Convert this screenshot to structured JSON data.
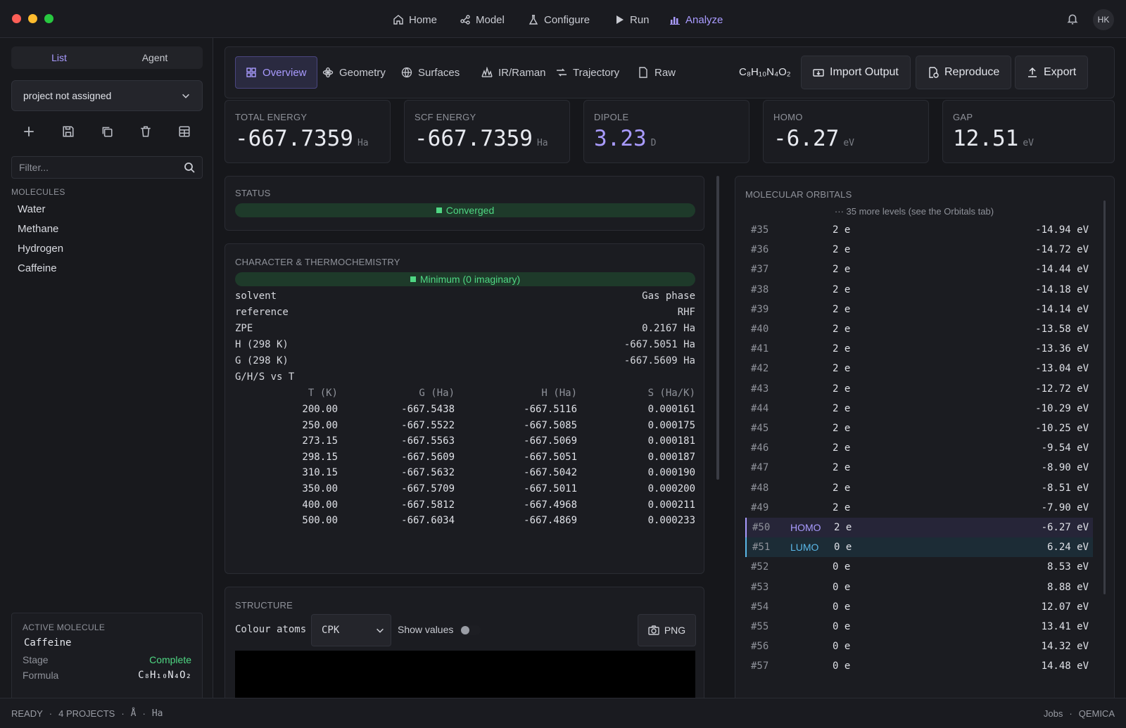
{
  "window": {
    "nav": [
      {
        "label": "Home",
        "icon": "home-icon"
      },
      {
        "label": "Model",
        "icon": "share-icon"
      },
      {
        "label": "Configure",
        "icon": "flask-icon"
      },
      {
        "label": "Run",
        "icon": "play-icon"
      },
      {
        "label": "Analyze",
        "icon": "bar-chart-icon",
        "active": true
      }
    ],
    "user_initials": "HK"
  },
  "sidebar": {
    "toggle": {
      "list": "List",
      "agent": "Agent"
    },
    "project": "project not assigned",
    "filter_placeholder": "Filter...",
    "molecules_label": "MOLECULES",
    "molecules": [
      "Water",
      "Methane",
      "Hydrogen",
      "Caffeine"
    ],
    "active": {
      "title": "ACTIVE MOLECULE",
      "name": "Caffeine",
      "stage_label": "Stage",
      "stage": "Complete",
      "formula_label": "Formula",
      "formula": "C₈H₁₀N₄O₂"
    }
  },
  "tabs": [
    "Overview",
    "Geometry",
    "Surfaces",
    "IR/Raman",
    "Trajectory",
    "Raw"
  ],
  "formula": "C₈H₁₀N₄O₂",
  "actions": {
    "import": "Import Output",
    "reproduce": "Reproduce",
    "export": "Export"
  },
  "metrics": [
    {
      "label": "TOTAL ENERGY",
      "value": "-667.7359",
      "unit": "Ha"
    },
    {
      "label": "SCF ENERGY",
      "value": "-667.7359",
      "unit": "Ha"
    },
    {
      "label": "DIPOLE",
      "value": "3.23",
      "unit": "D",
      "accent": "#a99bff"
    },
    {
      "label": "HOMO",
      "value": "-6.27",
      "unit": "eV"
    },
    {
      "label": "GAP",
      "value": "12.51",
      "unit": "eV"
    }
  ],
  "status": {
    "label": "STATUS",
    "value": "Converged"
  },
  "thermo": {
    "label": "CHARACTER & THERMOCHEMISTRY",
    "character": "Minimum (0 imaginary)",
    "props": [
      [
        "solvent",
        "Gas phase"
      ],
      [
        "reference",
        "RHF"
      ],
      [
        "ZPE",
        "0.2167 Ha"
      ],
      [
        "H (298 K)",
        "-667.5051 Ha"
      ],
      [
        "G (298 K)",
        "-667.5609 Ha"
      ]
    ],
    "table_title": "G/H/S vs T",
    "headers": [
      "T (K)",
      "G (Ha)",
      "H (Ha)",
      "S (Ha/K)"
    ],
    "rows": [
      [
        "200.00",
        "-667.5438",
        "-667.5116",
        "0.000161"
      ],
      [
        "250.00",
        "-667.5522",
        "-667.5085",
        "0.000175"
      ],
      [
        "273.15",
        "-667.5563",
        "-667.5069",
        "0.000181"
      ],
      [
        "298.15",
        "-667.5609",
        "-667.5051",
        "0.000187"
      ],
      [
        "310.15",
        "-667.5632",
        "-667.5042",
        "0.000190"
      ],
      [
        "350.00",
        "-667.5709",
        "-667.5011",
        "0.000200"
      ],
      [
        "400.00",
        "-667.5812",
        "-667.4968",
        "0.000211"
      ],
      [
        "500.00",
        "-667.6034",
        "-667.4869",
        "0.000233"
      ]
    ]
  },
  "structure": {
    "label": "STRUCTURE",
    "colour_label": "Colour atoms",
    "colour_value": "CPK",
    "show_values": "Show values",
    "png": "PNG"
  },
  "orbitals": {
    "label": "MOLECULAR ORBITALS",
    "more": "··· 35 more levels (see the Orbitals tab)",
    "rows": [
      [
        "#35",
        "",
        "2 e",
        "-14.94 eV"
      ],
      [
        "#36",
        "",
        "2 e",
        "-14.72 eV"
      ],
      [
        "#37",
        "",
        "2 e",
        "-14.44 eV"
      ],
      [
        "#38",
        "",
        "2 e",
        "-14.18 eV"
      ],
      [
        "#39",
        "",
        "2 e",
        "-14.14 eV"
      ],
      [
        "#40",
        "",
        "2 e",
        "-13.58 eV"
      ],
      [
        "#41",
        "",
        "2 e",
        "-13.36 eV"
      ],
      [
        "#42",
        "",
        "2 e",
        "-13.04 eV"
      ],
      [
        "#43",
        "",
        "2 e",
        "-12.72 eV"
      ],
      [
        "#44",
        "",
        "2 e",
        "-10.29 eV"
      ],
      [
        "#45",
        "",
        "2 e",
        "-10.25 eV"
      ],
      [
        "#46",
        "",
        "2 e",
        "-9.54 eV"
      ],
      [
        "#47",
        "",
        "2 e",
        "-8.90 eV"
      ],
      [
        "#48",
        "",
        "2 e",
        "-8.51 eV"
      ],
      [
        "#49",
        "",
        "2 e",
        "-7.90 eV"
      ],
      [
        "#50",
        "HOMO",
        "2 e",
        "-6.27 eV"
      ],
      [
        "#51",
        "LUMO",
        "0 e",
        "6.24 eV"
      ],
      [
        "#52",
        "",
        "0 e",
        "8.53 eV"
      ],
      [
        "#53",
        "",
        "0 e",
        "8.88 eV"
      ],
      [
        "#54",
        "",
        "0 e",
        "12.07 eV"
      ],
      [
        "#55",
        "",
        "0 e",
        "13.41 eV"
      ],
      [
        "#56",
        "",
        "0 e",
        "14.32 eV"
      ],
      [
        "#57",
        "",
        "0 e",
        "14.48 eV"
      ]
    ]
  },
  "statusbar": {
    "ready": "READY",
    "projects": "4 PROJECTS",
    "unit1": "Å",
    "unit2": "Ha",
    "jobs": "Jobs",
    "brand": "QEMICA",
    "sep": "·"
  }
}
